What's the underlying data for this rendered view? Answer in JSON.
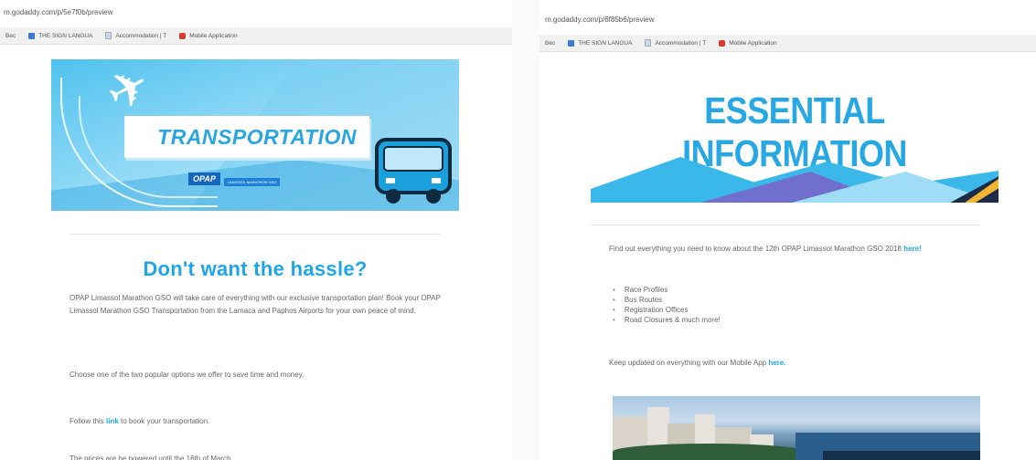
{
  "left_window": {
    "url": "m.godaddy.com/p/5e7f0b/preview",
    "bookmarks": [
      "Bec",
      "THE SIGN LANGUA",
      "Accommodation | T",
      "Mobile Application"
    ],
    "banner": {
      "title": "TRANSPORTATION",
      "logo": "OPAP",
      "tagline": "LIMASSOL MARATHON GSO",
      "badge": "12 2018"
    },
    "headline": "Don't want the hassle?",
    "para1": "OPAP Limassol Marathon GSO will take care of everything with our exclusive transportation plan! Book your OPAP Limassol Marathon GSO Transportation from the Larnaca and Paphos Airports for your own peace of mind.",
    "para2": "Choose one of the two popular options we offer to save time and money.",
    "para3_pre": "Follow this ",
    "para3_link": "link",
    "para3_post": " to book your transportation.",
    "para4": "The prices are be powered until the 16th of March"
  },
  "right_window": {
    "url": "m.godaddy.com/p/6f85b6/preview",
    "bookmarks": [
      "Bec",
      "THE SIGN LANGUA",
      "Accommodation | T",
      "Mobile Application"
    ],
    "banner_title": "ESSENTIAL INFORMATION",
    "intro_pre": "Find out everything you need to know about the 12th OPAP Limassol Marathon GSO 2018 ",
    "intro_link": "here!",
    "bullets": [
      "Race Profiles",
      "Bus Routes",
      "Registration Offices",
      "Road Closures & much more!"
    ],
    "app_pre": "Keep updated on everything with our Mobile App ",
    "app_link": "here."
  },
  "colors": {
    "accent": "#1ea6e6",
    "banner_light": "#8fd8f6",
    "banner_dark": "#2ea6dd"
  },
  "icons": [
    "bookmark-blue-icon",
    "bookmark-doc-icon",
    "bookmark-app-icon",
    "plane-icon",
    "bus-icon"
  ]
}
